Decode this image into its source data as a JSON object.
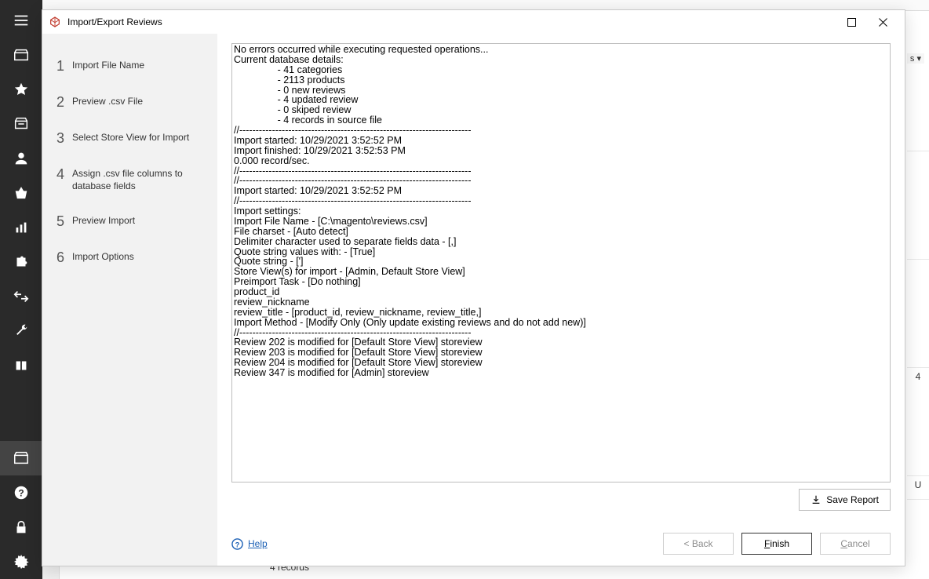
{
  "rail": {
    "top": [
      "hamburger",
      "box",
      "star",
      "inbox",
      "person",
      "basket",
      "chart",
      "puzzle",
      "transfer",
      "wrench",
      "stack"
    ],
    "bottom": [
      "archive",
      "help",
      "lock",
      "gear"
    ]
  },
  "bg": {
    "bottom_text": "4 records",
    "badge_s": "s ▾",
    "right_cells": [
      "",
      "",
      "",
      "4",
      "",
      "U"
    ]
  },
  "dialog": {
    "title": "Import/Export Reviews",
    "steps": [
      {
        "n": "1",
        "label": "Import File Name"
      },
      {
        "n": "2",
        "label": "Preview .csv File"
      },
      {
        "n": "3",
        "label": "Select Store View for Import"
      },
      {
        "n": "4",
        "label": "Assign .csv file columns to database fields"
      },
      {
        "n": "5",
        "label": "Preview Import"
      },
      {
        "n": "6",
        "label": "Import Options"
      }
    ],
    "log": "No errors occurred while executing requested operations...\nCurrent database details:\n                - 41 categories\n                - 2113 products\n                - 0 new reviews\n                - 4 updated review\n                - 0 skiped review\n                - 4 records in source file\n//-----------------------------------------------------------------------\nImport started: 10/29/2021 3:52:52 PM\nImport finished: 10/29/2021 3:52:53 PM\n0.000 record/sec.\n//-----------------------------------------------------------------------\n//-----------------------------------------------------------------------\nImport started: 10/29/2021 3:52:52 PM\n//-----------------------------------------------------------------------\nImport settings:\nImport File Name - [C:\\magento\\reviews.csv]\nFile charset - [Auto detect]\nDelimiter character used to separate fields data - [,]\nQuote string values with: - [True]\nQuote string - [']\nStore View(s) for import - [Admin, Default Store View]\nPreimport Task - [Do nothing]\nproduct_id\nreview_nickname\nreview_title - [product_id, review_nickname, review_title,]\nImport Method - [Modify Only (Only update existing reviews and do not add new)]\n//-----------------------------------------------------------------------\nReview 202 is modified for [Default Store View] storeview\nReview 203 is modified for [Default Store View] storeview\nReview 204 is modified for [Default Store View] storeview\nReview 347 is modified for [Admin] storeview",
    "save_report": "Save Report",
    "help": "Help",
    "back": "< Back",
    "finish_u": "F",
    "finish_rest": "inish",
    "cancel_u": "C",
    "cancel_rest": "ancel"
  }
}
